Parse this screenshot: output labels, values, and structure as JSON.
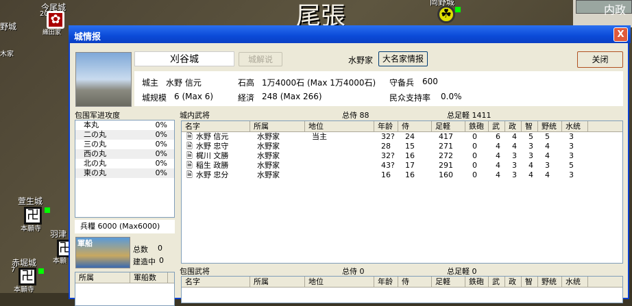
{
  "map": {
    "region": "尾張",
    "labels": [
      "今尾城",
      "20",
      "織田家",
      "野城",
      "木家",
      "萱生城",
      "本願寺",
      "羽津",
      "本願",
      "赤堀城",
      "7",
      "本願寺",
      "岡野城"
    ],
    "side_title": "内政"
  },
  "dialog": {
    "title": "城情报",
    "close_x": "X"
  },
  "castle": {
    "name": "刈谷城",
    "explain_btn": "城解说",
    "clan": "水野家",
    "clan_btn": "大名家情报",
    "close_btn": "关闭",
    "lord_label": "城主",
    "lord": "水野 信元",
    "koku_label": "石高",
    "koku": "1万4000石 (Max 1万4000石)",
    "garrison_label": "守备兵",
    "garrison": "600",
    "scale_label": "城规模",
    "scale": "6 (Max 6)",
    "econ_label": "経済",
    "econ": "248 (Max 266)",
    "support_label": "民众支持率",
    "support": "0.0%"
  },
  "siege_progress": {
    "label": "包围军进攻度",
    "items": [
      {
        "name": "本丸",
        "value": "0%"
      },
      {
        "name": "二の丸",
        "value": "0%"
      },
      {
        "name": "三の丸",
        "value": "0%"
      },
      {
        "name": "西の丸",
        "value": "0%"
      },
      {
        "name": "北の丸",
        "value": "0%"
      },
      {
        "name": "東の丸",
        "value": "0%"
      }
    ]
  },
  "provisions": "兵糧 6000 (Max6000)",
  "ships": {
    "img_label": "軍船",
    "total_label": "总数",
    "total": "0",
    "building_label": "建造中",
    "building": "0",
    "columns": [
      "所属",
      "軍船数"
    ]
  },
  "columns": [
    "名字",
    "所属",
    "地位",
    "年龄",
    "侍",
    "足軽",
    "鉄砲",
    "武",
    "政",
    "智",
    "野统",
    "水统"
  ],
  "inner": {
    "label": "城内武将",
    "samurai": "总侍 88",
    "ashigaru": "总足軽 1411",
    "rows": [
      [
        "水野 信元",
        "水野家",
        "当主",
        "32?",
        "24",
        "417",
        "0",
        "6",
        "4",
        "5",
        "5",
        "3"
      ],
      [
        "水野 忠守",
        "水野家",
        "",
        "28",
        "15",
        "271",
        "0",
        "4",
        "4",
        "3",
        "4",
        "3"
      ],
      [
        "梶川 文勝",
        "水野家",
        "",
        "32?",
        "16",
        "272",
        "0",
        "4",
        "3",
        "3",
        "4",
        "3"
      ],
      [
        "稲生 政勝",
        "水野家",
        "",
        "43?",
        "17",
        "291",
        "0",
        "4",
        "3",
        "4",
        "3",
        "5"
      ],
      [
        "水野 忠分",
        "水野家",
        "",
        "16",
        "16",
        "160",
        "0",
        "4",
        "3",
        "4",
        "4",
        "3"
      ]
    ]
  },
  "siege": {
    "label": "包围武将",
    "samurai": "总侍 0",
    "ashigaru": "总足軽 0"
  }
}
